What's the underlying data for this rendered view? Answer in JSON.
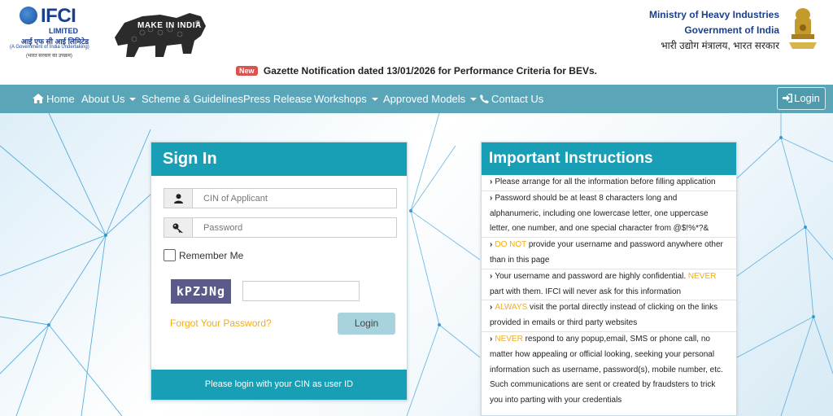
{
  "header": {
    "ifci": {
      "name": "IFCI",
      "limited": "LIMITED",
      "hindi": "आई एफ सी आई लिमिटेड",
      "govt_undertaking": "(A Government of India Undertaking)",
      "govt_hindi": "(भारत सरकार का उपक्रम)"
    },
    "make_in_india": "MAKE IN INDIA",
    "ministry": {
      "line1": "Ministry of Heavy Industries",
      "line2": "Government of India",
      "line3": "भारी उद्योग मंत्रालय, भारत सरकार"
    },
    "gazette": {
      "badge": "New",
      "text": "Gazette Notification dated 13/01/2026 for Performance Criteria for BEVs."
    }
  },
  "nav": {
    "home": "Home",
    "about": "About Us",
    "scheme": "Scheme & Guidelines",
    "press": "Press Release",
    "workshops": "Workshops",
    "approved": "Approved Models",
    "contact": "Contact Us",
    "login": "Login"
  },
  "signin": {
    "title": "Sign In",
    "cin_placeholder": "CIN of Applicant",
    "password_placeholder": "Password",
    "remember": "Remember Me",
    "captcha": "kPZJNg",
    "forgot": "Forgot Your Password?",
    "submit": "Login",
    "footer": "Please login with your CIN as user ID"
  },
  "instructions": {
    "title": "Important Instructions",
    "items": [
      {
        "pre": "Please arrange for all the information before filling application",
        "hl": "",
        "post": ""
      },
      {
        "pre": "Password should be at least 8 characters long and alphanumeric, including one lowercase letter, one uppercase letter, one number, and one special character from @$!%*?&",
        "hl": "",
        "post": ""
      },
      {
        "pre": "",
        "hl": "DO NOT",
        "post": " provide your username and password anywhere other than in this page"
      },
      {
        "pre": "Your username and password are highly confidential. ",
        "hl": "NEVER",
        "post": " part with them. IFCI will never ask for this information"
      },
      {
        "pre": "",
        "hl": "ALWAYS",
        "post": " visit the portal directly instead of clicking on the links provided in emails or third party websites"
      },
      {
        "pre": "",
        "hl": "NEVER",
        "post": " respond to any popup,email, SMS or phone call, no matter how appealing or official looking, seeking your personal information such as username, password(s), mobile number, etc. Such communications are sent or created by fraudsters to trick you into parting with your credentials"
      }
    ]
  },
  "colors": {
    "primary": "#199fb5",
    "navbar": "#5aa5b8",
    "highlight": "#f0ad1a"
  }
}
